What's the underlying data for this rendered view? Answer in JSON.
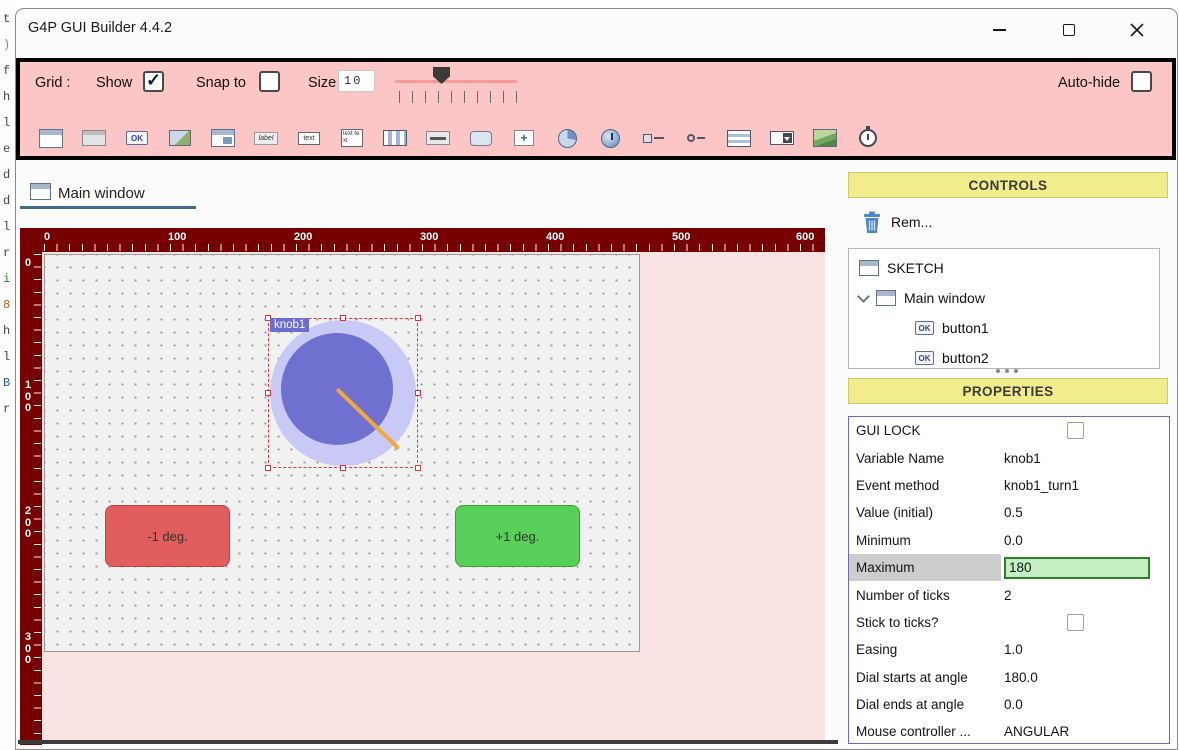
{
  "window": {
    "title": "G4P GUI Builder 4.4.2"
  },
  "editor_strip": {
    "chars": [
      "t",
      ")",
      "f",
      "h",
      "l",
      "e",
      "d",
      "d",
      "l",
      "r",
      "i",
      "8",
      "h",
      "l",
      "B",
      "r"
    ]
  },
  "toolbar": {
    "grid_label": "Grid :",
    "show_label": "Show",
    "show_checked": true,
    "snap_label": "Snap to",
    "snap_checked": false,
    "size_label": "Size",
    "size_value": "10",
    "autohide_label": "Auto-hide",
    "autohide_checked": false,
    "icons": [
      {
        "name": "window-icon",
        "text": ""
      },
      {
        "name": "panel-icon",
        "text": ""
      },
      {
        "name": "button-icon",
        "text": "OK"
      },
      {
        "name": "image-button-icon",
        "text": ""
      },
      {
        "name": "window-image-icon",
        "text": ""
      },
      {
        "name": "label-icon",
        "text": "label"
      },
      {
        "name": "textfield-icon",
        "text": "text"
      },
      {
        "name": "textarea-icon",
        "text": "text text"
      },
      {
        "name": "checkbox-group-icon",
        "text": ""
      },
      {
        "name": "slider-icon",
        "text": ""
      },
      {
        "name": "tooltip-icon",
        "text": ""
      },
      {
        "name": "custom-control-icon",
        "text": "+"
      },
      {
        "name": "dial-icon",
        "text": ""
      },
      {
        "name": "knob-icon",
        "text": ""
      },
      {
        "name": "slider-label-icon",
        "text": ""
      },
      {
        "name": "stepper-icon",
        "text": ""
      },
      {
        "name": "listbox-icon",
        "text": ""
      },
      {
        "name": "droplist-icon",
        "text": ""
      },
      {
        "name": "sketch-image-icon",
        "text": ""
      },
      {
        "name": "timer-icon",
        "text": ""
      }
    ]
  },
  "tab": {
    "label": "Main window"
  },
  "canvas": {
    "h_ruler": [
      "0",
      "100",
      "200",
      "300",
      "400",
      "500",
      "600"
    ],
    "v_ruler": [
      "0",
      "100",
      "200",
      "300"
    ],
    "knob": {
      "label": "knob1"
    },
    "button_minus": {
      "label": "-1 deg.",
      "fill": "#e25e5e"
    },
    "button_plus": {
      "label": "+1 deg.",
      "fill": "#58cf58"
    }
  },
  "controls": {
    "header": "CONTROLS",
    "remove_label": "Rem...",
    "tree": [
      {
        "label": "SKETCH"
      },
      {
        "label": "Main window"
      },
      {
        "label": "button1"
      },
      {
        "label": "button2"
      }
    ]
  },
  "properties": {
    "header": "PROPERTIES",
    "rows": [
      {
        "label": "GUI LOCK",
        "value": ""
      },
      {
        "label": "Variable Name",
        "value": "knob1"
      },
      {
        "label": "Event method",
        "value": "knob1_turn1"
      },
      {
        "label": "Value (initial)",
        "value": "0.5"
      },
      {
        "label": "Minimum",
        "value": "0.0"
      },
      {
        "label": "Maximum",
        "value": "180"
      },
      {
        "label": "Number of ticks",
        "value": "2"
      },
      {
        "label": "Stick to ticks?",
        "value": ""
      },
      {
        "label": "Easing",
        "value": "1.0"
      },
      {
        "label": "Dial starts at angle",
        "value": "180.0"
      },
      {
        "label": "Dial ends at angle",
        "value": "0.0"
      },
      {
        "label": "Mouse controller ...",
        "value": "ANGULAR"
      }
    ]
  },
  "colors": {
    "toolbar_bg": "#fcc6c6",
    "ruler_bg": "#760000",
    "canvas_bg": "#fbe3e4",
    "section_header_bg": "#f1ed8d",
    "knob_outer": "#c9c9f6",
    "knob_inner": "#7070d0",
    "knob_needle": "#f2a93b",
    "selection_red": "#e03535",
    "edit_field_bg": "#c4f1c4",
    "edit_field_border": "#2e7d32",
    "tab_accent": "#44688e"
  }
}
